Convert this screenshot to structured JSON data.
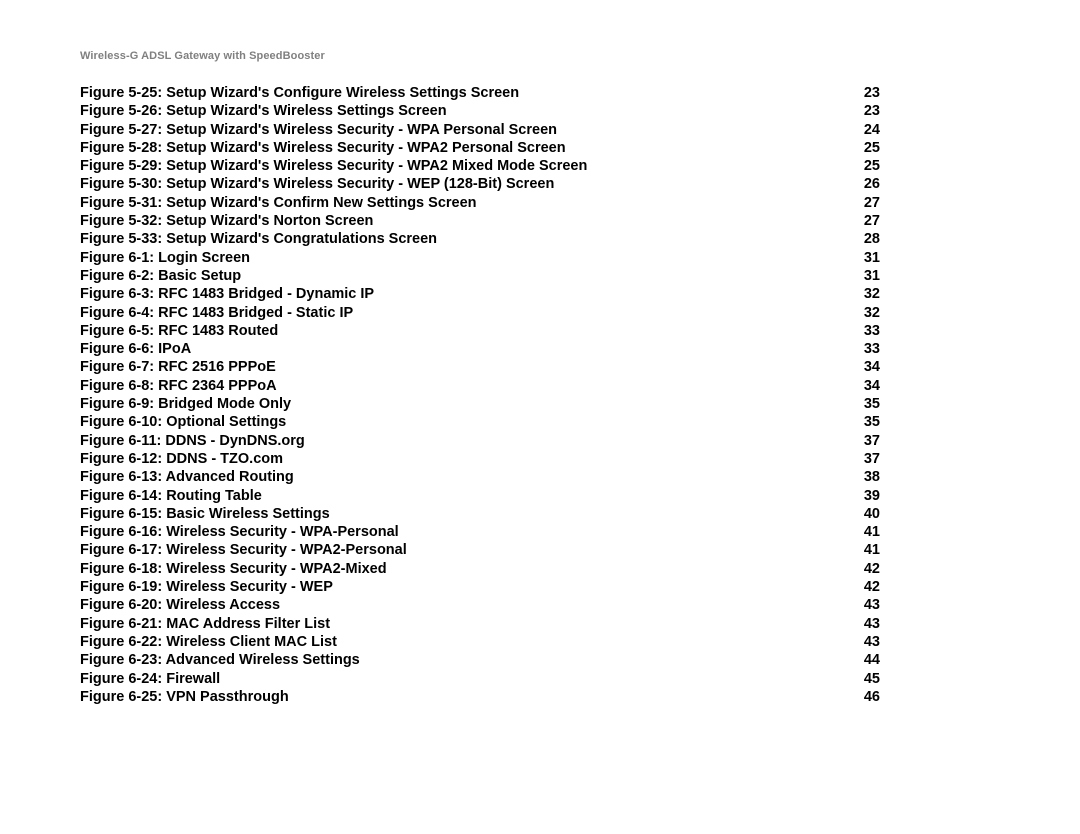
{
  "header": "Wireless-G ADSL Gateway with SpeedBooster",
  "entries": [
    {
      "title": "Figure 5-25: Setup Wizard's Configure Wireless Settings Screen",
      "page": "23"
    },
    {
      "title": "Figure 5-26: Setup Wizard's Wireless Settings Screen",
      "page": "23"
    },
    {
      "title": "Figure 5-27: Setup Wizard's Wireless Security - WPA Personal Screen",
      "page": "24"
    },
    {
      "title": "Figure 5-28: Setup Wizard's Wireless Security - WPA2 Personal Screen",
      "page": "25"
    },
    {
      "title": "Figure 5-29: Setup Wizard's Wireless Security - WPA2 Mixed Mode Screen",
      "page": "25"
    },
    {
      "title": "Figure 5-30: Setup Wizard's Wireless Security - WEP (128-Bit) Screen",
      "page": "26"
    },
    {
      "title": "Figure 5-31: Setup Wizard's Confirm New Settings Screen",
      "page": "27"
    },
    {
      "title": "Figure 5-32: Setup Wizard's Norton Screen",
      "page": "27"
    },
    {
      "title": "Figure 5-33: Setup Wizard's Congratulations Screen",
      "page": "28"
    },
    {
      "title": "Figure 6-1: Login Screen",
      "page": "31"
    },
    {
      "title": "Figure 6-2: Basic Setup",
      "page": "31"
    },
    {
      "title": "Figure 6-3: RFC 1483 Bridged - Dynamic IP",
      "page": "32"
    },
    {
      "title": "Figure 6-4: RFC 1483 Bridged - Static IP",
      "page": "32"
    },
    {
      "title": "Figure 6-5: RFC 1483 Routed",
      "page": "33"
    },
    {
      "title": "Figure 6-6: IPoA",
      "page": "33"
    },
    {
      "title": "Figure 6-7: RFC 2516 PPPoE",
      "page": "34"
    },
    {
      "title": "Figure 6-8: RFC 2364 PPPoA",
      "page": "34"
    },
    {
      "title": "Figure 6-9: Bridged Mode Only",
      "page": "35"
    },
    {
      "title": "Figure 6-10: Optional Settings",
      "page": "35"
    },
    {
      "title": "Figure 6-11: DDNS - DynDNS.org",
      "page": "37"
    },
    {
      "title": "Figure 6-12: DDNS - TZO.com",
      "page": "37"
    },
    {
      "title": "Figure 6-13: Advanced Routing",
      "page": "38"
    },
    {
      "title": "Figure 6-14: Routing Table",
      "page": "39"
    },
    {
      "title": "Figure 6-15: Basic Wireless Settings",
      "page": "40"
    },
    {
      "title": "Figure 6-16: Wireless Security - WPA-Personal",
      "page": "41"
    },
    {
      "title": "Figure 6-17: Wireless Security - WPA2-Personal",
      "page": "41"
    },
    {
      "title": "Figure 6-18: Wireless Security - WPA2-Mixed",
      "page": "42"
    },
    {
      "title": "Figure 6-19: Wireless Security - WEP",
      "page": "42"
    },
    {
      "title": "Figure 6-20: Wireless Access",
      "page": "43"
    },
    {
      "title": "Figure 6-21: MAC Address Filter List",
      "page": "43"
    },
    {
      "title": "Figure 6-22: Wireless Client MAC List",
      "page": "43"
    },
    {
      "title": "Figure 6-23: Advanced Wireless Settings",
      "page": "44"
    },
    {
      "title": "Figure 6-24: Firewall",
      "page": "45"
    },
    {
      "title": "Figure 6-25: VPN Passthrough",
      "page": "46"
    }
  ]
}
